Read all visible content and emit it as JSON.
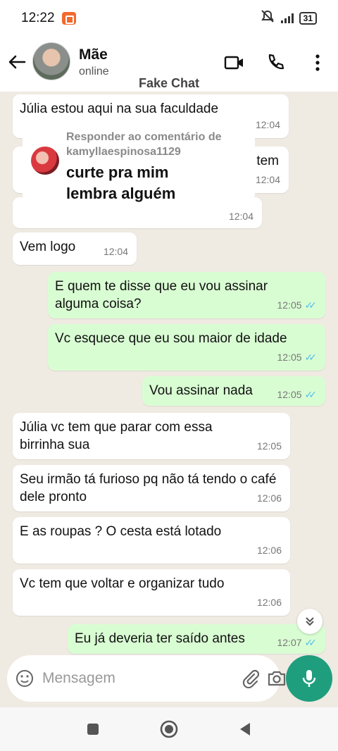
{
  "status_bar": {
    "time": "12:22",
    "battery": "31"
  },
  "header": {
    "contact_name": "Mãe",
    "contact_status": "online",
    "subtitle": "Fake Chat"
  },
  "overlay": {
    "title_line1": "Responder ao comentário de",
    "title_line2": "kamyllaespinosa1129",
    "body_line1": "curte pra mim",
    "body_line2": "lembra alguém"
  },
  "messages": [
    {
      "dir": "in",
      "text": "Júlia estou aqui na sua faculdade",
      "time": "12:04"
    },
    {
      "dir": "in",
      "text": "tem",
      "time": "12:04"
    },
    {
      "dir": "in",
      "text": "",
      "time": "12:04"
    },
    {
      "dir": "in",
      "text": "Vem logo",
      "time": "12:04"
    },
    {
      "dir": "out",
      "text": "E quem te disse que eu vou assinar alguma coisa?",
      "time": "12:05"
    },
    {
      "dir": "out",
      "text": "Vc esquece que eu sou maior de idade",
      "time": "12:05"
    },
    {
      "dir": "out",
      "text": "Vou assinar nada",
      "time": "12:05"
    },
    {
      "dir": "in",
      "text": "Júlia vc tem que parar com essa birrinha sua",
      "time": "12:05"
    },
    {
      "dir": "in",
      "text": "Seu irmão tá furioso pq não tá tendo o café dele pronto",
      "time": "12:06"
    },
    {
      "dir": "in",
      "text": "E as roupas ? O cesta está lotado",
      "time": "12:06"
    },
    {
      "dir": "in",
      "text": "Vc tem que voltar e organizar tudo",
      "time": "12:06"
    },
    {
      "dir": "out",
      "text": "Eu já deveria ter saído antes",
      "time": "12:07"
    }
  ],
  "input": {
    "placeholder": "Mensagem"
  },
  "colors": {
    "accent": "#1f9e7d",
    "out_bubble": "#d9fdd3",
    "tick_read": "#53bdeb"
  }
}
